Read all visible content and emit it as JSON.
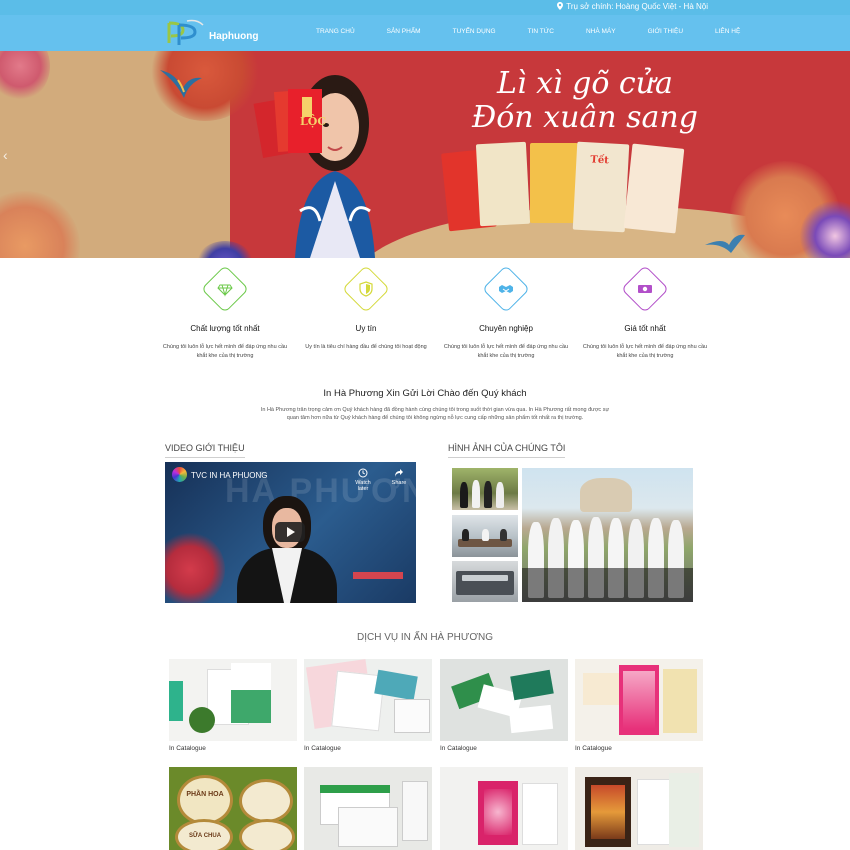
{
  "topbar": {
    "address": "Trụ sở chính: Hoàng Quốc Việt - Hà Nội"
  },
  "header": {
    "logo_text": "Haphuong",
    "nav": [
      "TRANG CHỦ",
      "SẢN PHẨM",
      "TUYỂN DỤNG",
      "TIN TỨC",
      "NHÀ MÁY",
      "GIỚI THIỆU",
      "LIÊN HỆ"
    ]
  },
  "banner": {
    "headline_line1": "Lì xì gõ cửa",
    "headline_line2": "Đón xuân sang",
    "envelope_texts": [
      "LỘC",
      "Tết"
    ]
  },
  "features": [
    {
      "title": "Chất lượng tốt nhất",
      "desc": "Chúng tôi luôn lỗ lực hết mình để đáp ứng nhu cầu khắt khe của thị trường",
      "color": "#6cc94a",
      "icon": "diamond-icon"
    },
    {
      "title": "Uy tín",
      "desc": "Uy tín là tiêu chí hàng đầu để chúng tôi hoạt động",
      "color": "#d4d93a",
      "icon": "shield-icon"
    },
    {
      "title": "Chuyên nghiệp",
      "desc": "Chúng tôi luôn lỗ lực hết mình để đáp ứng nhu cầu khắt khe của thị trường",
      "color": "#4fb3e8",
      "icon": "handshake-icon"
    },
    {
      "title": "Giá tốt nhất",
      "desc": "Chúng tôi luôn lỗ lực hết mình để đáp ứng nhu cầu khắt khe của thị trường",
      "color": "#b24fc9",
      "icon": "money-icon"
    }
  ],
  "welcome": {
    "title": "In Hà Phương Xin Gửi Lời Chào đến Quý khách",
    "text": "In Hà Phương trân trọng cảm ơn Quý khách hàng đã đồng hành cùng chúng tôi trong suốt thời gian vừa qua. In Hà Phương rất mong được sự quan tâm hơn nữa từ Quý khách hàng để chúng tôi không ngừng nỗ lực cung cấp những sản phẩm tốt nhất ra thị trường."
  },
  "video_section": {
    "heading": "VIDEO GIỚI THIỆU",
    "video_title": "TVC IN HA PHUONG",
    "watch_later": "Watch later",
    "share": "Share",
    "bg_text": "HÀ PHƯƠNG"
  },
  "photo_section": {
    "heading": "HÌNH ẢNH CỦA CHÚNG TÔI"
  },
  "services": {
    "heading": "DỊCH VỤ IN ẤN HÀ PHƯƠNG",
    "items": [
      {
        "label": "In Catalogue"
      },
      {
        "label": "In Catalogue"
      },
      {
        "label": "In Catalogue"
      },
      {
        "label": "In Catalogue"
      },
      {
        "label": ""
      },
      {
        "label": ""
      },
      {
        "label": ""
      },
      {
        "label": ""
      }
    ],
    "product_texts": [
      "PHẦN HOA",
      "SỮA CHUA"
    ]
  }
}
